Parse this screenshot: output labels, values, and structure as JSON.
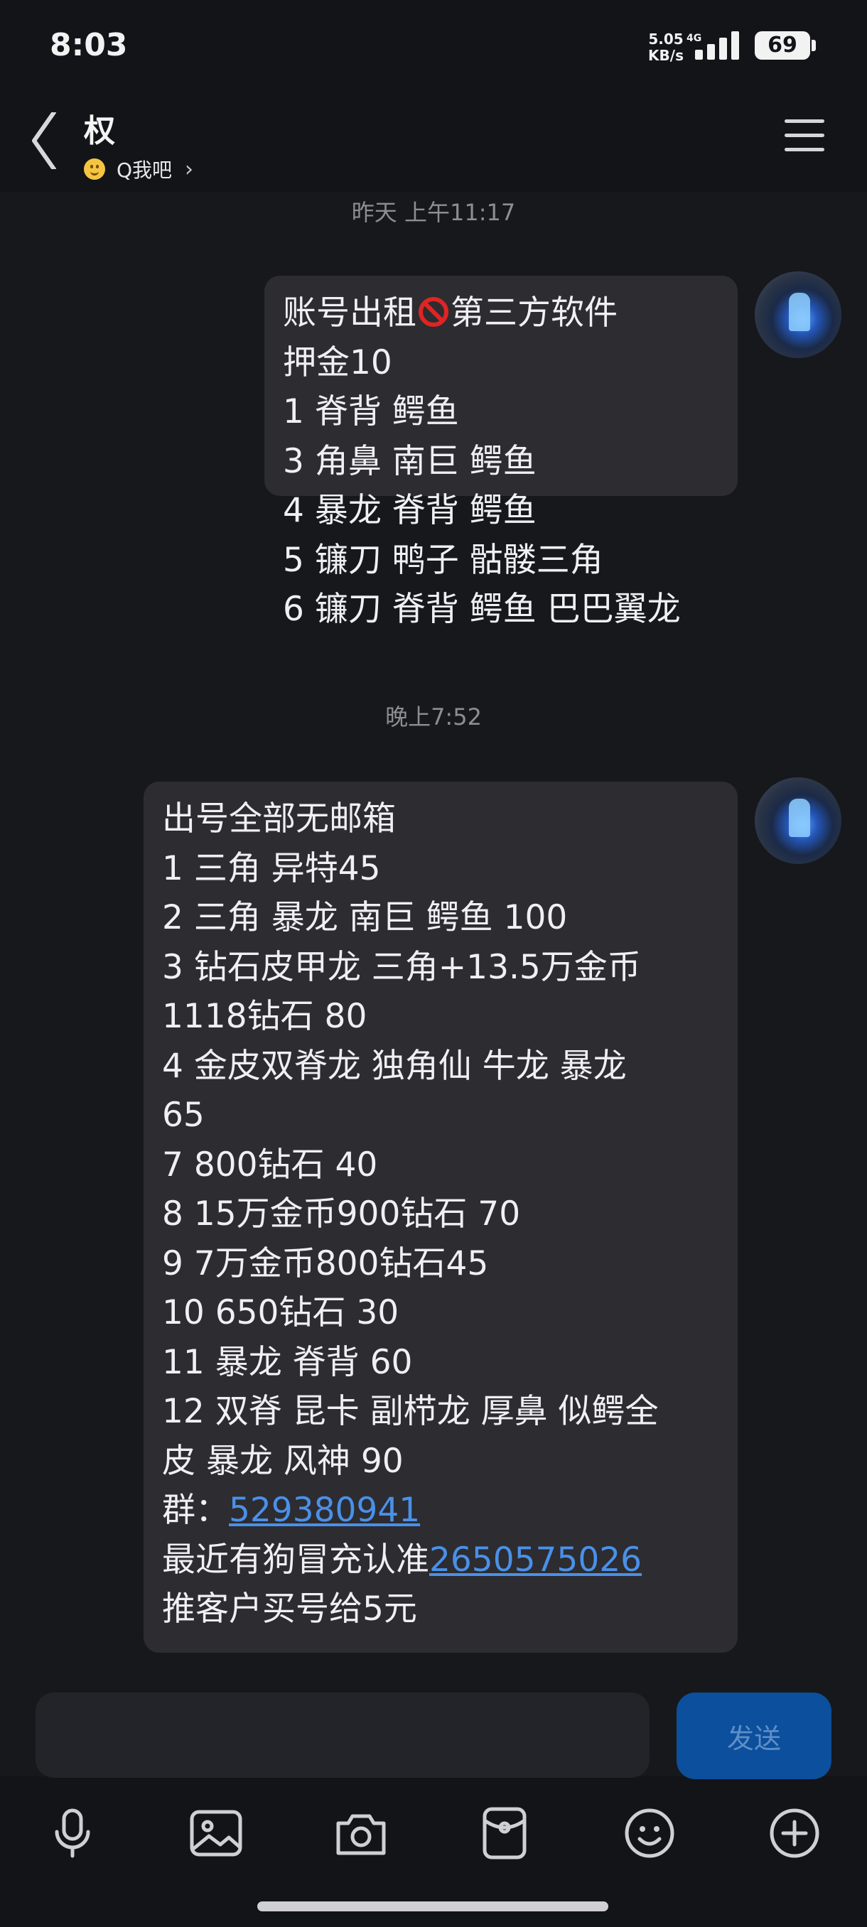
{
  "status_bar": {
    "time": "8:03",
    "net_speed_value": "5.05",
    "net_speed_unit": "KB/s",
    "network_type": "4G",
    "battery": "69"
  },
  "header": {
    "contact_name": "权",
    "status_text": "Q我吧",
    "chevron": "›"
  },
  "messages": [
    {
      "timestamp": "昨天 上午11:17",
      "lines_before_icon": "账号出租",
      "icon": "no-entry-icon",
      "lines_after_icon": "第三方软件\n押金10\n1 脊背 鳄鱼\n3 角鼻 南巨 鳄鱼\n4 暴龙 脊背 鳄鱼\n5 镰刀 鸭子 骷髅三角\n6 镰刀 脊背 鳄鱼 巴巴翼龙"
    },
    {
      "timestamp": "晚上7:52",
      "body": "出号全部无邮箱\n1 三角 异特45\n2 三角 暴龙 南巨 鳄鱼 100\n3 钻石皮甲龙 三角+13.5万金币\n1118钻石 80\n4 金皮双脊龙 独角仙 牛龙 暴龙\n65\n7 800钻石 40\n8 15万金币900钻石 70\n9 7万金币800钻石45\n10 650钻石 30\n11 暴龙 脊背 60\n12 双脊 昆卡 副栉龙 厚鼻 似鳄全\n皮 暴龙 风神 90\n",
      "group_label": "群：",
      "group_number": "529380941",
      "warning_prefix": "最近有狗冒充认准",
      "warning_number": "2650575026",
      "footer": "推客户买号给5元"
    }
  ],
  "input": {
    "placeholder": "",
    "send_label": "发送"
  },
  "toolbar_icons": [
    "microphone-icon",
    "image-icon",
    "camera-icon",
    "red-packet-icon",
    "emoji-icon",
    "plus-icon"
  ],
  "colors": {
    "background": "#16181c",
    "bubble": "#2c2c31",
    "link": "#4a90e8",
    "send_button": "#0c4f9c"
  }
}
